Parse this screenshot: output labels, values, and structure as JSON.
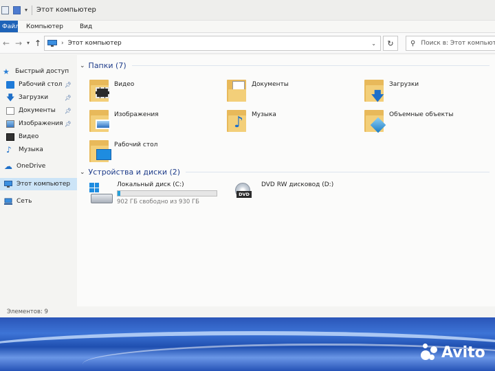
{
  "window": {
    "title": "Этот компьютер"
  },
  "ribbon": {
    "file_tab": "Файл",
    "tabs": [
      "Компьютер",
      "Вид"
    ]
  },
  "address": {
    "path": "Этот компьютер",
    "search_placeholder": "Поиск в: Этот компьютер"
  },
  "sidebar": {
    "items": [
      {
        "label": "Быстрый доступ",
        "icon": "star-icon",
        "pinned": false
      },
      {
        "label": "Рабочий стол",
        "icon": "desktop-folder-icon",
        "pinned": true
      },
      {
        "label": "Загрузки",
        "icon": "download-arrow-icon",
        "pinned": true
      },
      {
        "label": "Документы",
        "icon": "document-icon",
        "pinned": true
      },
      {
        "label": "Изображения",
        "icon": "picture-icon",
        "pinned": true
      },
      {
        "label": "Видео",
        "icon": "video-icon",
        "pinned": false
      },
      {
        "label": "Музыка",
        "icon": "music-note-icon",
        "pinned": false
      },
      {
        "label": "OneDrive",
        "icon": "cloud-icon",
        "pinned": false
      },
      {
        "label": "Этот компьютер",
        "icon": "computer-icon",
        "pinned": false
      },
      {
        "label": "Сеть",
        "icon": "network-icon",
        "pinned": false
      }
    ]
  },
  "folders_group": {
    "header": "Папки (7)",
    "items": [
      {
        "label": "Видео",
        "icon": "video-folder-icon"
      },
      {
        "label": "Документы",
        "icon": "documents-folder-icon"
      },
      {
        "label": "Загрузки",
        "icon": "downloads-folder-icon"
      },
      {
        "label": "Изображения",
        "icon": "pictures-folder-icon"
      },
      {
        "label": "Музыка",
        "icon": "music-folder-icon"
      },
      {
        "label": "Объемные объекты",
        "icon": "3d-objects-folder-icon"
      },
      {
        "label": "Рабочий стол",
        "icon": "desktop-folder-icon"
      }
    ]
  },
  "drives_group": {
    "header": "Устройства и диски (2)",
    "items": [
      {
        "label": "Локальный диск (C:)",
        "free_text": "902 ГБ свободно из 930 ГБ",
        "used_fraction": 0.03,
        "icon": "hard-drive-icon"
      },
      {
        "label": "DVD RW дисковод (D:)",
        "badge": "DVD",
        "icon": "dvd-drive-icon"
      }
    ]
  },
  "status": {
    "items_text": "Элементов: 9"
  },
  "colors": {
    "accent": "#1e63b8",
    "group_header": "#1e3c8a",
    "drive_bar": "#26a0da",
    "folder": "#f3cf79",
    "selection": "#cce4f7"
  },
  "watermark": "Avito"
}
